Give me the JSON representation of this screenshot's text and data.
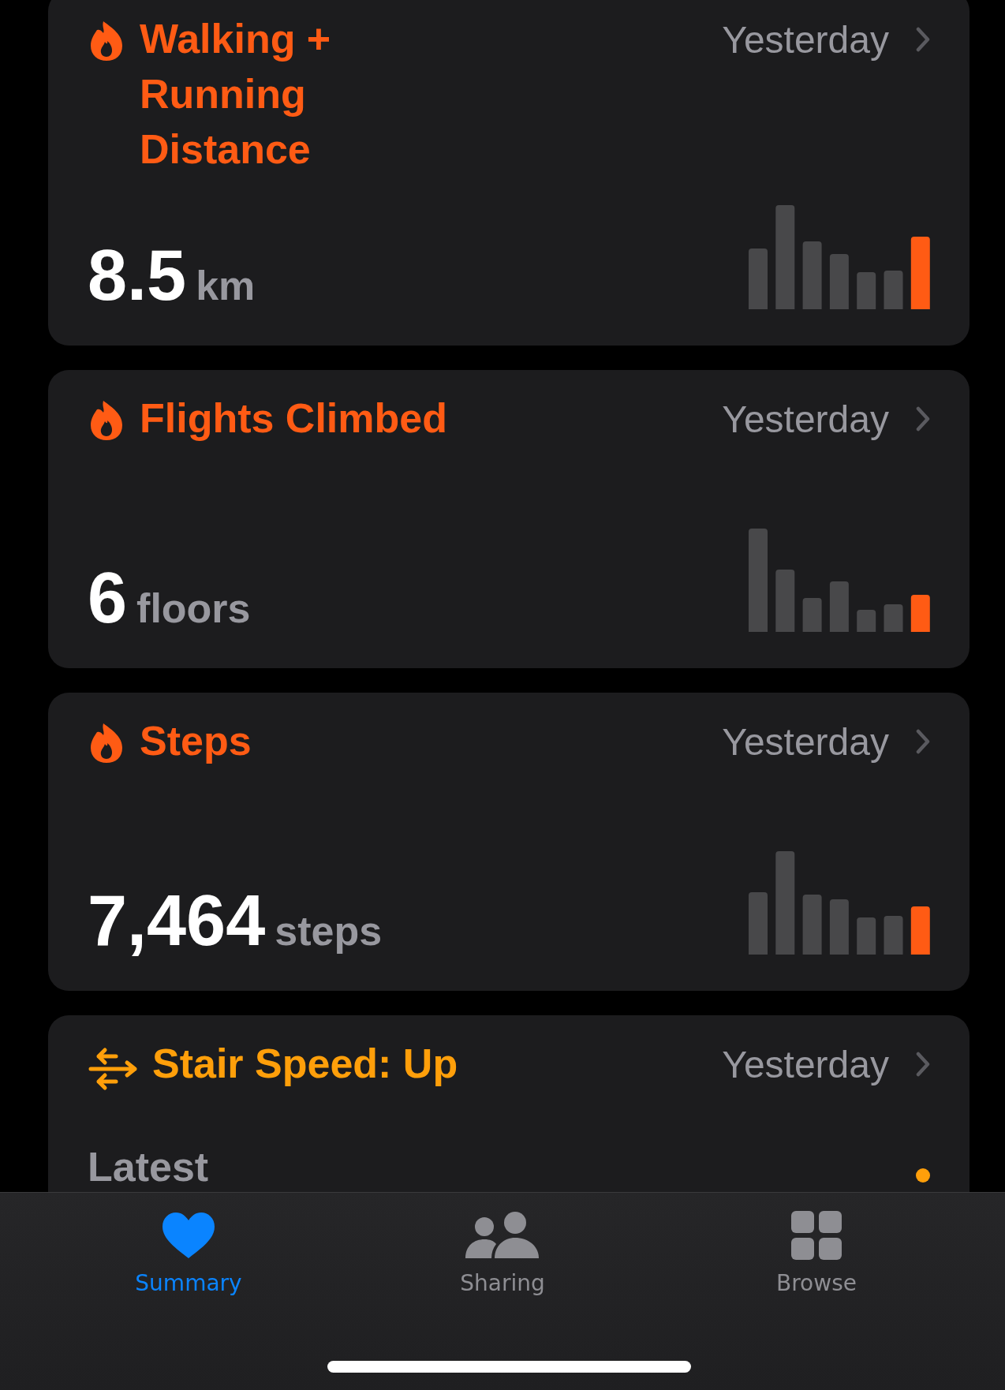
{
  "cards": [
    {
      "kind": "chart",
      "title": "Walking + Running Distance",
      "date": "Yesterday",
      "value": "8.5",
      "unit": "km"
    },
    {
      "kind": "chart",
      "title": "Flights Climbed",
      "date": "Yesterday",
      "value": "6",
      "unit": "floors"
    },
    {
      "kind": "chart",
      "title": "Steps",
      "date": "Yesterday",
      "value": "7,464",
      "unit": "steps"
    },
    {
      "kind": "latest",
      "title": "Stair Speed: Up",
      "date": "Yesterday",
      "label": "Latest"
    }
  ],
  "tabs": [
    {
      "label": "Summary",
      "selected": true
    },
    {
      "label": "Sharing",
      "selected": false
    },
    {
      "label": "Browse",
      "selected": false
    }
  ]
}
